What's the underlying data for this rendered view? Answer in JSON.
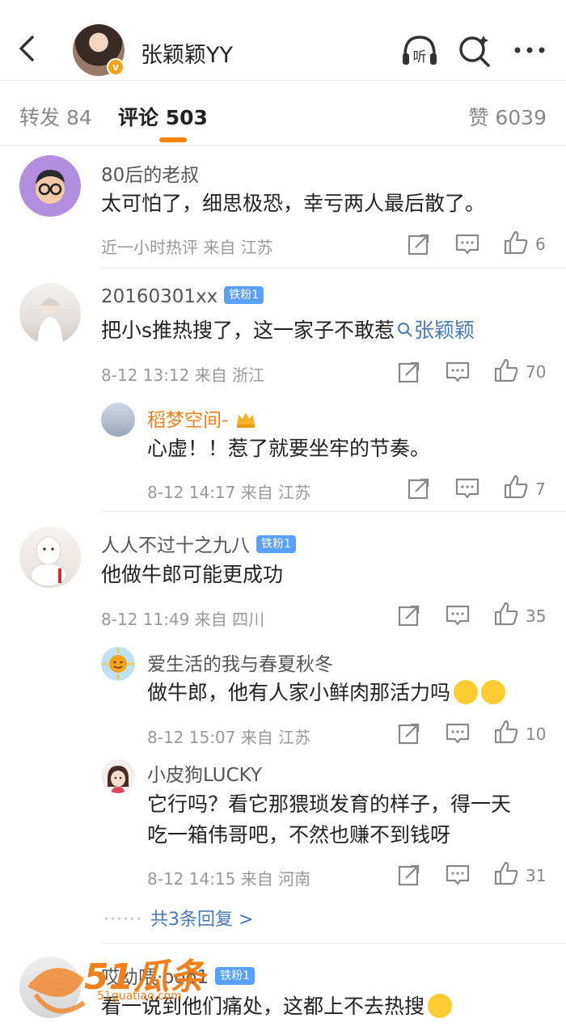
{
  "header": {
    "username": "张颖颖YY",
    "verified_badge": "v",
    "icons": [
      "back-icon",
      "listen-icon",
      "search-icon",
      "more-icon"
    ],
    "listen_label": "听"
  },
  "tabs": {
    "repost": "转发 84",
    "comment": "评论 503",
    "like": "赞 6039"
  },
  "comments": [
    {
      "user": "80后的老叔",
      "text": "太可怕了，细思极恐，幸亏两人最后散了。",
      "meta": "近一小时热评  来自 江苏",
      "likes": "6"
    },
    {
      "user": "20160301xx",
      "fan_badge": "铁粉1",
      "text_before": "把小s推热搜了，这一家子不敢惹",
      "hashtag": "张颖颖",
      "meta": "8-12 13:12  来自 浙江",
      "likes": "70",
      "replies": [
        {
          "user": "稻梦空间-",
          "text": "心虚！！惹了就要坐牢的节奏。",
          "meta": "8-12 14:17  来自 江苏",
          "likes": "7"
        }
      ]
    },
    {
      "user": "人人不过十之九八",
      "fan_badge": "铁粉1",
      "text": "他做牛郎可能更成功",
      "meta": "8-12 11:49  来自 四川",
      "likes": "35",
      "replies": [
        {
          "user": "爱生活的我与春夏秋冬",
          "text": "做牛郎，他有人家小鲜肉那活力吗",
          "meta": "8-12 15:07  来自 江苏",
          "likes": "10"
        },
        {
          "user": "小皮狗LUCKY",
          "text_line1": "它行吗？看它那猥琐发育的样子，得一天",
          "text_line2": "吃一箱伟哥吧，不然也赚不到钱呀",
          "meta": "8-12 14:15  来自 河南",
          "likes": "31"
        }
      ],
      "more_replies": "共3条回复 >",
      "more_dots": "······"
    },
    {
      "user": "哎幼喂·ooo1",
      "fan_badge": "铁粉1",
      "text": "看一说到他们痛处，这都上不去热搜"
    }
  ],
  "watermark": {
    "text": "51瓜条",
    "url": "51guatiao.com"
  }
}
